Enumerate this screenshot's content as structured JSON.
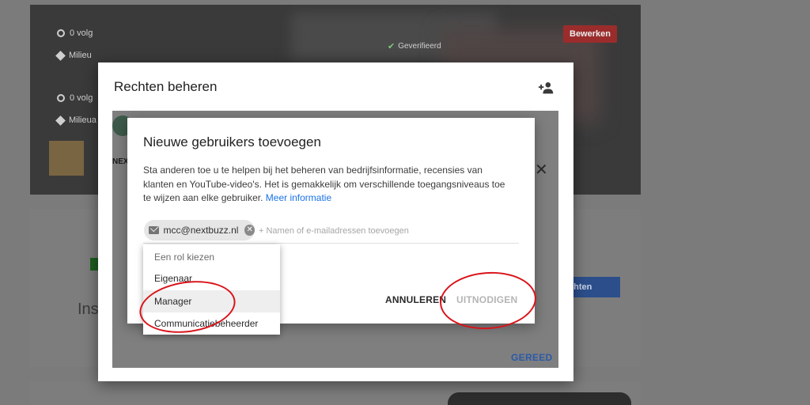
{
  "background": {
    "followers_1": "0 volg",
    "tag_1": "Milieu",
    "followers_2": "0 volg",
    "tag_2": "Milieua",
    "verified": "Geverifieerd",
    "edit_button": "Bewerken",
    "ins_text": "Ins",
    "blue_button": "ichten",
    "logo_text": "NEX BUZ"
  },
  "outer_dialog": {
    "title": "Rechten beheren",
    "done_button": "GEREED"
  },
  "inner_dialog": {
    "title": "Nieuwe gebruikers toevoegen",
    "description": "Sta anderen toe u te helpen bij het beheren van bedrijfsinformatie, recensies van klanten en YouTube-video's. Het is gemakkelijk om verschillende toegangsniveaus toe te wijzen aan elke gebruiker.",
    "more_info_link": "Meer informatie",
    "chip_email": "mcc@nextbuzz.nl",
    "input_placeholder": "+ Namen of e-mailadressen toevoegen",
    "cancel_button": "ANNULEREN",
    "invite_button": "UITNODIGEN"
  },
  "role_menu": {
    "header": "Een rol kiezen",
    "items": [
      "Eigenaar",
      "Manager",
      "Communicatiebeheerder"
    ],
    "highlighted": "Manager"
  },
  "colors": {
    "accent_link": "#1a73e8",
    "done_blue": "#2c5aa8",
    "annotation_red": "#d9131a",
    "edit_red": "#9b2c2c"
  },
  "icons": [
    "link-icon",
    "tag-icon",
    "check-icon",
    "add-person-icon",
    "close-icon",
    "mail-icon",
    "remove-chip-icon"
  ]
}
